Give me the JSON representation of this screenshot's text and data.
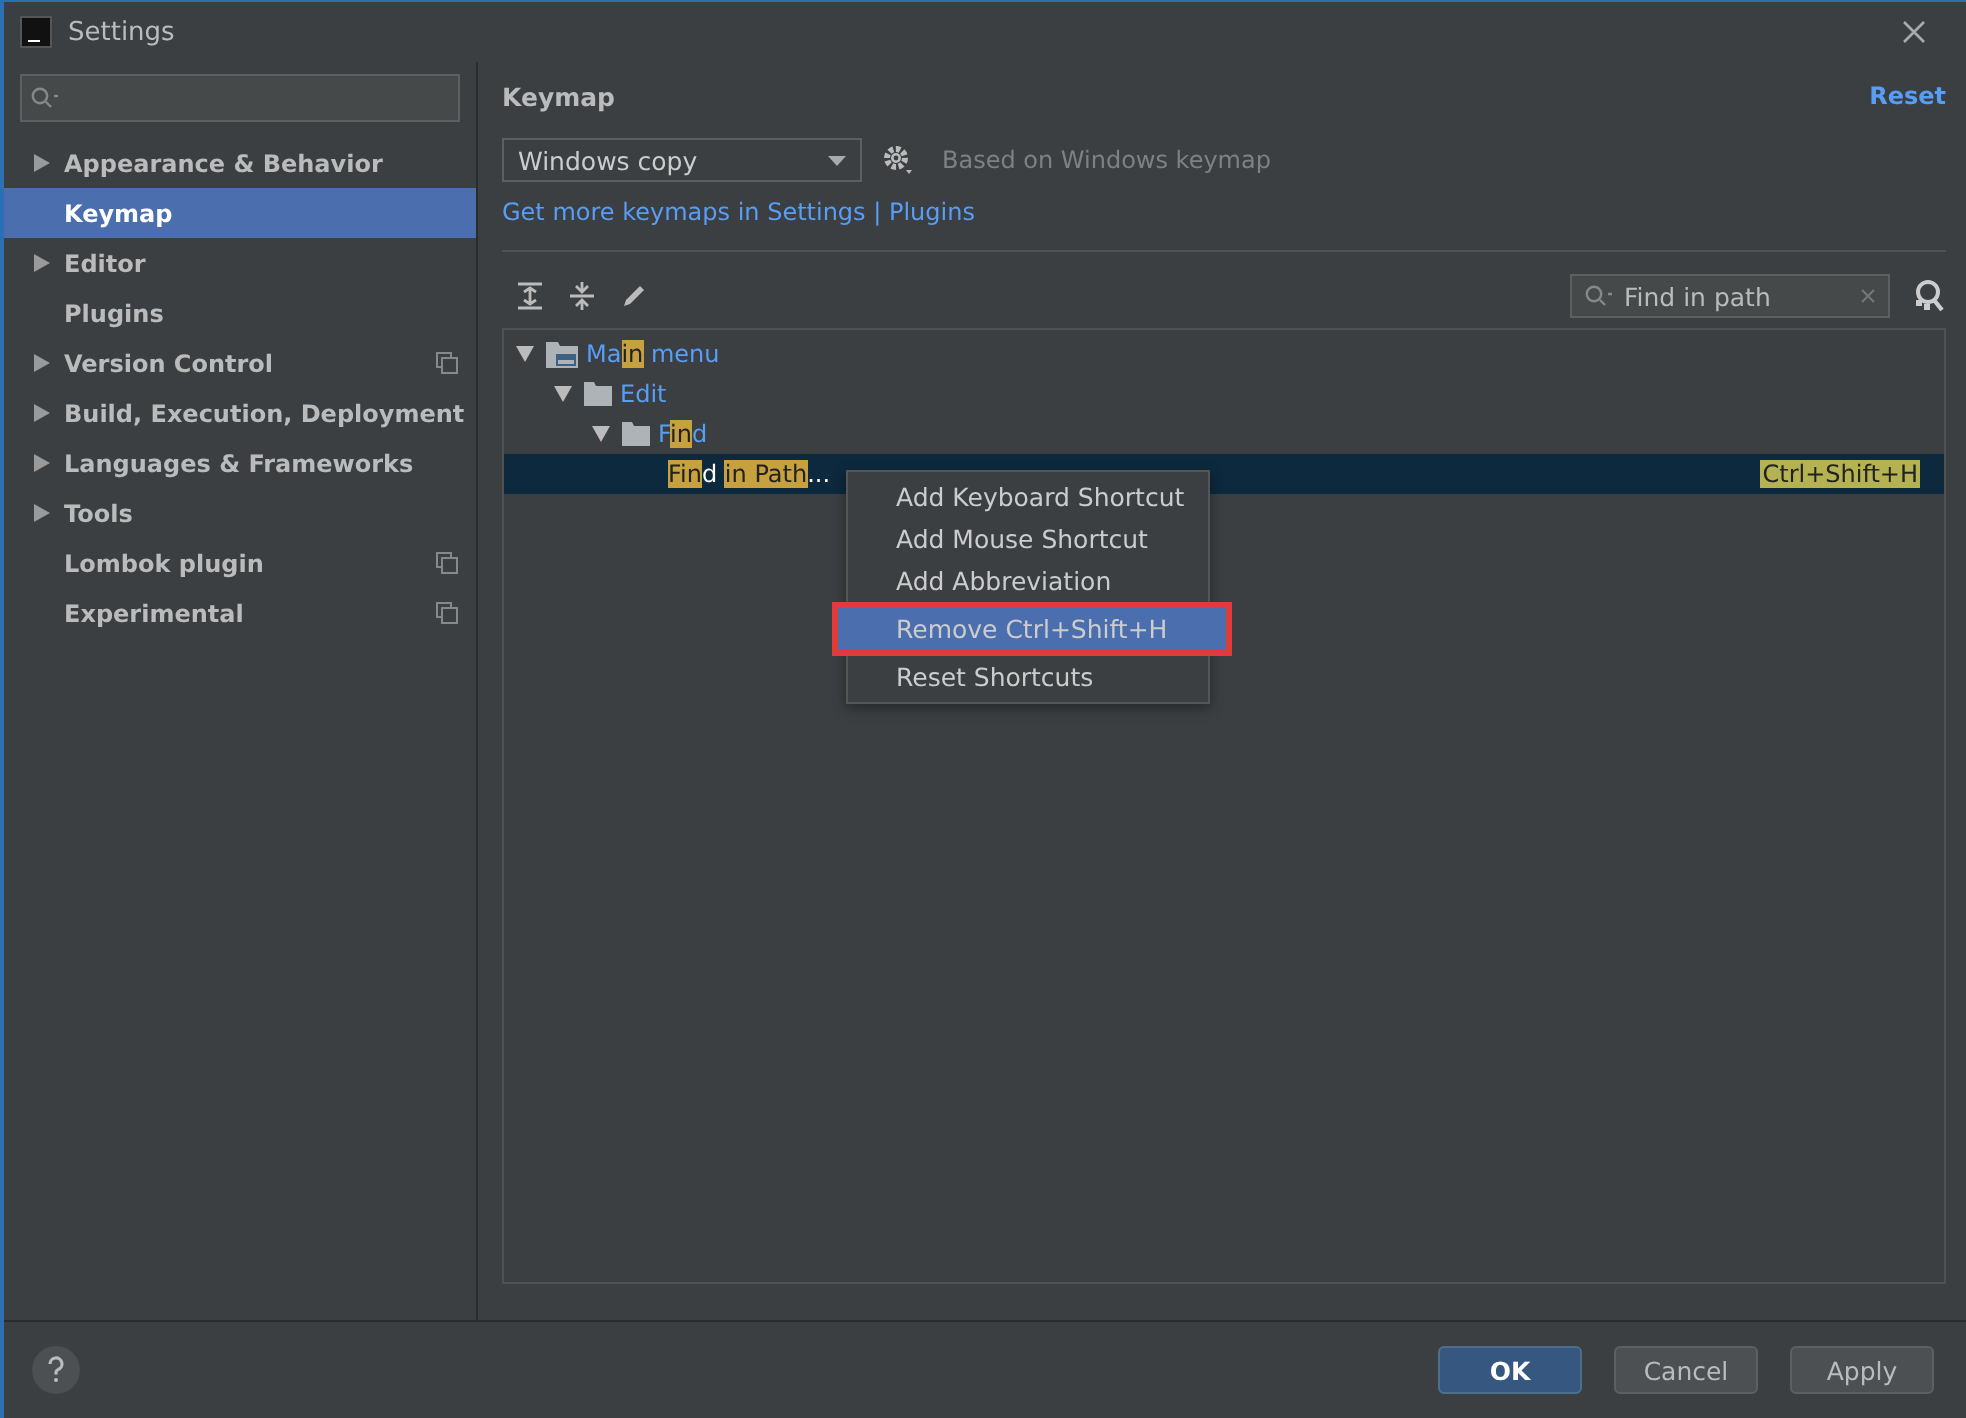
{
  "window": {
    "title": "Settings"
  },
  "sidebar": {
    "items": [
      {
        "label": "Appearance & Behavior",
        "expandable": true,
        "selected": false,
        "project_scoped": false
      },
      {
        "label": "Keymap",
        "expandable": false,
        "selected": true,
        "project_scoped": false
      },
      {
        "label": "Editor",
        "expandable": true,
        "selected": false,
        "project_scoped": false
      },
      {
        "label": "Plugins",
        "expandable": false,
        "selected": false,
        "project_scoped": false
      },
      {
        "label": "Version Control",
        "expandable": true,
        "selected": false,
        "project_scoped": true
      },
      {
        "label": "Build, Execution, Deployment",
        "expandable": true,
        "selected": false,
        "project_scoped": false
      },
      {
        "label": "Languages & Frameworks",
        "expandable": true,
        "selected": false,
        "project_scoped": false
      },
      {
        "label": "Tools",
        "expandable": true,
        "selected": false,
        "project_scoped": false
      },
      {
        "label": "Lombok plugin",
        "expandable": false,
        "selected": false,
        "project_scoped": true
      },
      {
        "label": "Experimental",
        "expandable": false,
        "selected": false,
        "project_scoped": true
      }
    ]
  },
  "page": {
    "title": "Keymap",
    "reset": "Reset",
    "keymap_select": "Windows copy",
    "based_on": "Based on Windows keymap",
    "link": "Get more keymaps in Settings | Plugins",
    "search": {
      "value": "Find in path"
    },
    "tree": [
      {
        "kind": "menu",
        "expanded": true,
        "selected": false,
        "segments": [
          {
            "text": "Ma",
            "match": false
          },
          {
            "text": "in",
            "match": true
          },
          {
            "text": " menu",
            "match": false
          }
        ],
        "children": [
          {
            "kind": "folder",
            "expanded": true,
            "selected": false,
            "segments": [
              {
                "text": "Edit",
                "match": false
              }
            ],
            "children": [
              {
                "kind": "folder",
                "expanded": true,
                "selected": false,
                "segments": [
                  {
                    "text": "F",
                    "match": false
                  },
                  {
                    "text": "in",
                    "match": true
                  },
                  {
                    "text": "d",
                    "match": false
                  }
                ],
                "children": [
                  {
                    "kind": "action",
                    "expanded": false,
                    "selected": true,
                    "segments": [
                      {
                        "text": "F",
                        "match": true
                      },
                      {
                        "text": "in",
                        "match": true
                      },
                      {
                        "text": "d ",
                        "match": false
                      },
                      {
                        "text": "in ",
                        "match": true
                      },
                      {
                        "text": "Path",
                        "match": true
                      },
                      {
                        "text": "...",
                        "match": false
                      }
                    ],
                    "shortcut": "Ctrl+Shift+H"
                  }
                ]
              }
            ]
          }
        ]
      }
    ],
    "context_menu": [
      {
        "label": "Add Keyboard Shortcut",
        "selected": false,
        "highlighted": false
      },
      {
        "label": "Add Mouse Shortcut",
        "selected": false,
        "highlighted": false
      },
      {
        "label": "Add Abbreviation",
        "selected": false,
        "highlighted": false
      },
      {
        "label": "Remove Ctrl+Shift+H",
        "selected": true,
        "highlighted": true
      },
      {
        "label": "Reset Shortcuts",
        "selected": false,
        "highlighted": false
      }
    ]
  },
  "buttons": [
    {
      "label": "OK",
      "kind": "primary"
    },
    {
      "label": "Cancel",
      "kind": "normal"
    },
    {
      "label": "Apply",
      "kind": "normal"
    }
  ]
}
